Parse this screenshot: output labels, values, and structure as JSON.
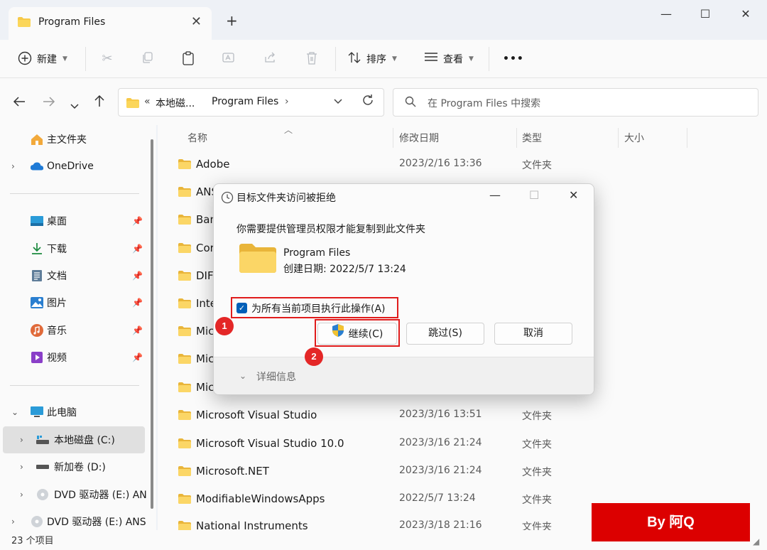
{
  "window": {
    "tab_title": "Program Files",
    "tab_close": "✕",
    "new_tab": "+",
    "minimize": "—",
    "maximize": "☐",
    "close": "✕"
  },
  "commandbar": {
    "new_label": "新建",
    "sort_label": "排序",
    "view_label": "查看",
    "more": "•••"
  },
  "address": {
    "overflow": "«",
    "part1": "本地磁...",
    "separator": "›",
    "part2": "Program Files",
    "search_placeholder": "在 Program Files 中搜索"
  },
  "sidebar": {
    "home": "主文件夹",
    "onedrive": "OneDrive",
    "desktop": "桌面",
    "downloads": "下载",
    "documents": "文档",
    "pictures": "图片",
    "music": "音乐",
    "videos": "视频",
    "this_pc": "此电脑",
    "c_drive": "本地磁盘 (C:)",
    "d_drive": "新加卷 (D:)",
    "e_drive1": "DVD 驱动器 (E:) AN",
    "e_drive2": "DVD 驱动器 (E:) ANS"
  },
  "columns": {
    "name": "名称",
    "modified": "修改日期",
    "type": "类型",
    "size": "大小"
  },
  "files": [
    {
      "name": "Adobe",
      "date": "2023/2/16 13:36",
      "type": "文件夹"
    },
    {
      "name": "ANS",
      "date": "",
      "type": ""
    },
    {
      "name": "Ban",
      "date": "",
      "type": ""
    },
    {
      "name": "Cor",
      "date": "",
      "type": ""
    },
    {
      "name": "DIF",
      "date": "",
      "type": ""
    },
    {
      "name": "Inte",
      "date": "",
      "type": ""
    },
    {
      "name": "Mic",
      "date": "",
      "type": ""
    },
    {
      "name": "Mic",
      "date": "",
      "type": ""
    },
    {
      "name": "Mic",
      "date": "",
      "type": ""
    },
    {
      "name": "Microsoft Visual Studio",
      "date": "2023/3/16 13:51",
      "type": "文件夹"
    },
    {
      "name": "Microsoft Visual Studio 10.0",
      "date": "2023/3/16 21:24",
      "type": "文件夹"
    },
    {
      "name": "Microsoft.NET",
      "date": "2023/3/16 21:24",
      "type": "文件夹"
    },
    {
      "name": "ModifiableWindowsApps",
      "date": "2022/5/7 13:24",
      "type": "文件夹"
    },
    {
      "name": "National Instruments",
      "date": "2023/3/18 21:16",
      "type": "文件夹"
    }
  ],
  "status": {
    "item_count": "23 个项目"
  },
  "dialog": {
    "title": "目标文件夹访问被拒绝",
    "message": "你需要提供管理员权限才能复制到此文件夹",
    "folder_name": "Program Files",
    "created": "创建日期: 2022/5/7 13:24",
    "checkbox_label": "为所有当前项目执行此操作(A)",
    "continue": "继续(C)",
    "skip": "跳过(S)",
    "cancel": "取消",
    "details": "详细信息",
    "badge1": "1",
    "badge2": "2"
  },
  "watermark": "By 阿Q",
  "colors": {
    "accent": "#005fb8",
    "highlight": "#e01c1c",
    "folder": "#f7c948"
  }
}
